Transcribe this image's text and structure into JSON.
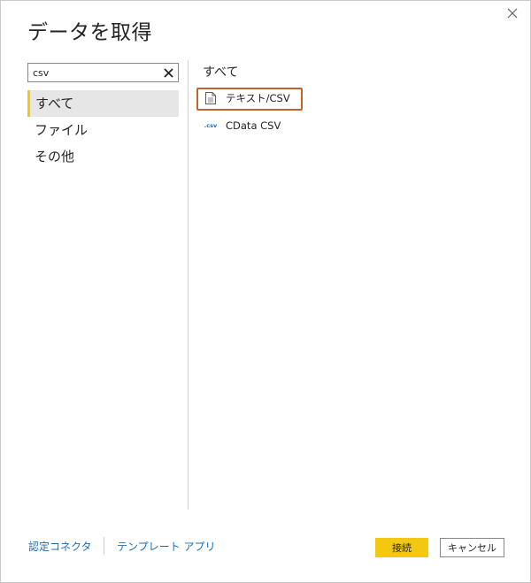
{
  "dialog": {
    "title": "データを取得",
    "close_icon": "close-icon"
  },
  "search": {
    "value": "csv",
    "clear_icon": "clear-icon"
  },
  "categories": [
    {
      "label": "すべて",
      "selected": true
    },
    {
      "label": "ファイル",
      "selected": false
    },
    {
      "label": "その他",
      "selected": false
    }
  ],
  "results": {
    "heading": "すべて",
    "items": [
      {
        "label": "テキスト/CSV",
        "icon": "document-icon",
        "highlighted": true
      },
      {
        "label": "CData CSV",
        "icon": "csv-icon",
        "icon_text": ".csv"
      }
    ]
  },
  "footer": {
    "link_certified": "認定コネクタ",
    "link_template": "テンプレート アプリ",
    "connect_label": "接続",
    "cancel_label": "キャンセル"
  },
  "colors": {
    "accent": "#f2c811",
    "link": "#1b6fb5",
    "highlight_border": "#c4622d"
  }
}
